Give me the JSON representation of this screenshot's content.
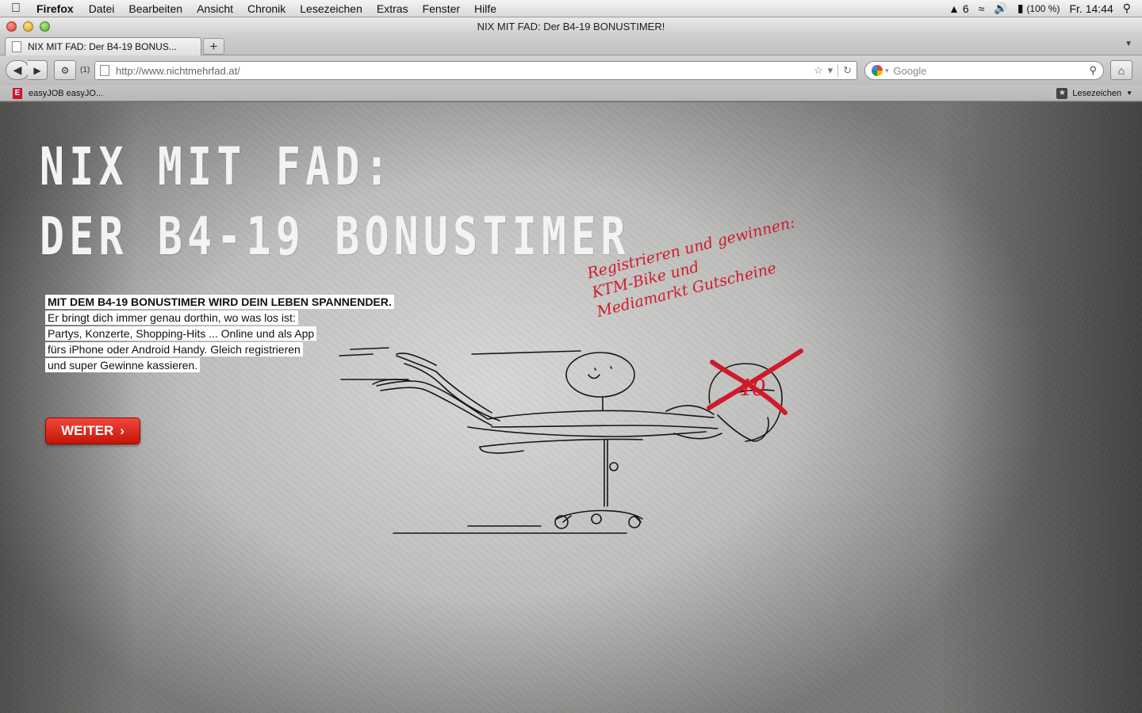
{
  "menubar": {
    "app": "Firefox",
    "items": [
      "Datei",
      "Bearbeiten",
      "Ansicht",
      "Chronik",
      "Lesezeichen",
      "Extras",
      "Fenster",
      "Hilfe"
    ],
    "status": {
      "adobe_count": "6",
      "battery": "(100 %)",
      "clock": "Fr. 14:44"
    }
  },
  "window": {
    "title": "NIX MIT FAD: Der B4-19 BONUSTIMER!"
  },
  "tabs": [
    {
      "label": "NIX MIT FAD: Der B4-19 BONUS..."
    }
  ],
  "toolbar": {
    "new_tab": "+",
    "history_count": "(1)",
    "url": "http://www.nichtmehrfad.at/",
    "search_placeholder": "Google"
  },
  "bookmarks": {
    "items": [
      {
        "label": "easyJOB easyJO..."
      }
    ],
    "menu_label": "Lesezeichen"
  },
  "page": {
    "headline_line1": "NIX MIT FAD:",
    "headline_line2": "DER B4-19 BONUSTIMER",
    "intro_bold": "MIT DEM B4-19 BONUSTIMER WIRD DEIN LEBEN SPANNENDER.",
    "intro_lines": [
      "Er bringt dich immer genau dorthin, wo was los ist:",
      "Partys, Konzerte, Shopping-Hits ... Online und als App",
      "fürs iPhone oder Android Handy. Gleich registrieren",
      "und super Gewinne kassieren."
    ],
    "button_label": "WEITER",
    "handwritten": [
      "Registrieren und gewinnen:",
      "KTM-Bike und",
      "Mediamarkt Gutscheine"
    ],
    "helmet_label": "40"
  },
  "colors": {
    "accent": "#d1192a",
    "button": "#e0281c"
  }
}
